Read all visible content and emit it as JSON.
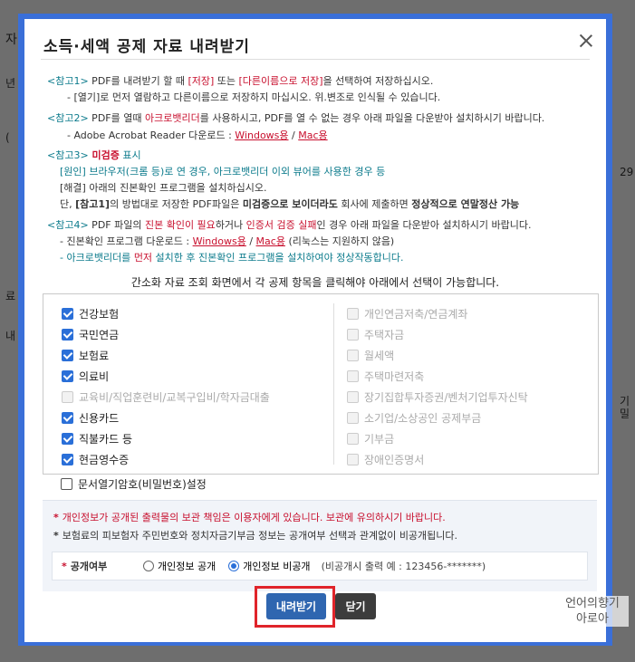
{
  "background": {
    "fragments": [
      "자",
      "년",
      "(",
      "29",
      "료",
      "내",
      "기",
      "밀"
    ]
  },
  "dialog": {
    "title": "소득·세액 공제 자료 내려받기",
    "notes": {
      "n1_tag": "<참고1>",
      "n1_a": " PDF를 내려받기 할 때 ",
      "n1_b": "[저장]",
      "n1_c": " 또는 ",
      "n1_d": "[다른이름으로 저장]",
      "n1_e": "을 선택하여 저장하십시오.",
      "n1_line2": "- [열기]로 먼저 열람하고 다른이름으로 저장하지 마십시오. 위.변조로 인식될 수 있습니다.",
      "n2_tag": "<참고2>",
      "n2_a": " PDF를 열때 ",
      "n2_b": "아크로뱃리더",
      "n2_c": "를 사용하시고, PDF를 열 수 없는 경우 아래 파일을 다운받아 설치하시기 바랍니다.",
      "n2_line2": "- Adobe Acrobat Reader 다운로드 : ",
      "n2_win": "Windows용",
      "n2_slash": " / ",
      "n2_mac": "Mac용",
      "n3_tag": "<참고3>",
      "n3_title": " 미검증",
      "n3_title2": " 표시",
      "n3_line1": "[원인] 브라우저(크롬 등)로 연 경우, 아크로뱃리더 이외 뷰어를 사용한 경우 등",
      "n3_line2": "[해결] 아래의 진본확인 프로그램을 설치하십시오.",
      "n3_line3a": "단, ",
      "n3_line3b": "[참고1]",
      "n3_line3c": "의 방법대로 저장한 PDF파일은 ",
      "n3_line3d": "미검증으로 보이더라도",
      "n3_line3e": " 회사에 제출하면 ",
      "n3_line3f": "정상적으로 연말정산 가능",
      "n4_tag": "<참고4>",
      "n4_a": " PDF 파일의 ",
      "n4_b": "진본 확인이 필요",
      "n4_c": "하거나 ",
      "n4_d": "인증서 검증 실패",
      "n4_e": "인 경우 아래 파일을 다운받아 설치하시기 바랍니다.",
      "n4_line2": "- 진본확인 프로그램 다운로드 : ",
      "n4_win": "Windows용",
      "n4_slash": " / ",
      "n4_mac": "Mac용",
      "n4_paren": " (리눅스는 지원하지 않음)",
      "n4_line3a": "- 아크로뱃리더를 ",
      "n4_line3b": "먼저",
      "n4_line3c": " 설치한 후 진본확인 프로그램을 설치하여야 정상작동합니다."
    },
    "select_hint": "간소화 자료 조회 화면에서 각 공제 항목을 클릭해야 아래에서 선택이 가능합니다.",
    "left_items": [
      {
        "label": "건강보험",
        "state": "on"
      },
      {
        "label": "국민연금",
        "state": "on"
      },
      {
        "label": "보험료",
        "state": "on"
      },
      {
        "label": "의료비",
        "state": "on"
      },
      {
        "label": "교육비/직업훈련비/교복구입비/학자금대출",
        "state": "dis"
      },
      {
        "label": "신용카드",
        "state": "on"
      },
      {
        "label": "직불카드 등",
        "state": "on"
      },
      {
        "label": "현금영수증",
        "state": "on"
      }
    ],
    "right_items": [
      {
        "label": "개인연금저축/연금계좌",
        "state": "dis"
      },
      {
        "label": "주택자금",
        "state": "dis"
      },
      {
        "label": "월세액",
        "state": "dis"
      },
      {
        "label": "주택마련저축",
        "state": "dis"
      },
      {
        "label": "장기집합투자증권/벤처기업투자신탁",
        "state": "dis"
      },
      {
        "label": "소기업/소상공인 공제부금",
        "state": "dis"
      },
      {
        "label": "기부금",
        "state": "dis"
      },
      {
        "label": "장애인증명서",
        "state": "dis"
      }
    ],
    "password_label": "문서열기암호(비밀번호)설정",
    "privacy": {
      "line1": "개인정보가 공개된 출력물의 보관 책임은 이용자에게 있습니다. 보관에 유의하시기 바랍니다.",
      "line2": "보험료의 피보험자 주민번호와 정치자금기부금 정보는 공개여부 선택과 관계없이 비공개됩니다.",
      "star1": "*",
      "star2": "*",
      "disclose_label": "공개여부",
      "opt_public": "개인정보 공개",
      "opt_private": "개인정보 비공개",
      "private_example": "(비공개시 출력 예 : 123456-*******)"
    },
    "download_btn": "내려받기",
    "close_btn": "닫기"
  },
  "watermark": {
    "line1": "언어의향기",
    "line2": "아로아"
  },
  "colors": {
    "accent": "#2a6fd8",
    "frame": "#3a6fd8",
    "highlight": "#e0242a",
    "note_tag": "#0c7b8c",
    "warning": "#c8102e"
  }
}
